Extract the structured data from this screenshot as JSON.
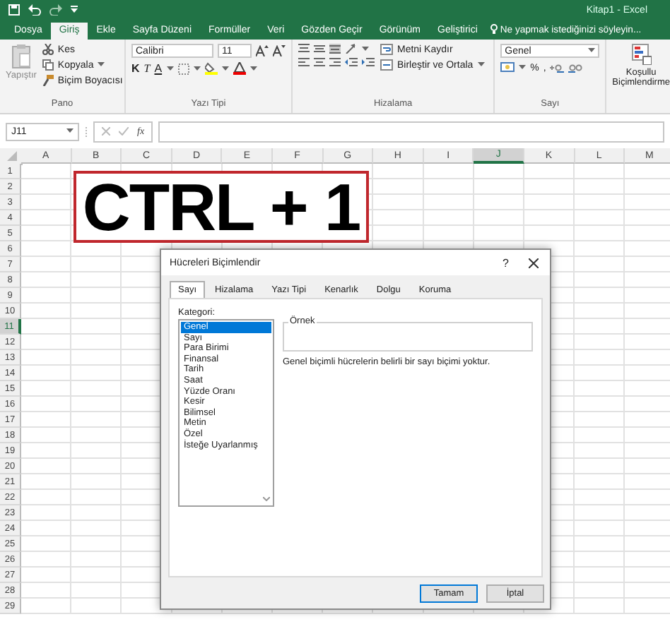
{
  "window": {
    "title": "Kitap1 - Excel"
  },
  "ribbon_tabs": [
    {
      "label": "Dosya",
      "selected": false
    },
    {
      "label": "Giriş",
      "selected": true
    },
    {
      "label": "Ekle",
      "selected": false
    },
    {
      "label": "Sayfa Düzeni",
      "selected": false
    },
    {
      "label": "Formüller",
      "selected": false
    },
    {
      "label": "Veri",
      "selected": false
    },
    {
      "label": "Gözden Geçir",
      "selected": false
    },
    {
      "label": "Görünüm",
      "selected": false
    },
    {
      "label": "Geliştirici",
      "selected": false
    }
  ],
  "tell_me": "Ne yapmak istediğinizi söyleyin...",
  "ribbon": {
    "clipboard": {
      "paste": "Yapıştır",
      "cut": "Kes",
      "copy": "Kopyala",
      "format_painter": "Biçim Boyacısı",
      "group": "Pano"
    },
    "font": {
      "name": "Calibri",
      "size": "11",
      "bold": "K",
      "italic": "T",
      "underline": "A",
      "group": "Yazı Tipi"
    },
    "alignment": {
      "wrap": "Metni Kaydır",
      "merge": "Birleştir ve Ortala",
      "group": "Hizalama"
    },
    "number": {
      "format": "Genel",
      "percent": "%",
      "comma": ",",
      "group": "Sayı"
    },
    "conditional": [
      "Koşullu",
      "Biçimlendirme"
    ]
  },
  "formula_bar": {
    "name_box": "J11",
    "fx": "fx"
  },
  "sheet": {
    "columns": [
      {
        "label": "A",
        "selected": false
      },
      {
        "label": "B",
        "selected": false
      },
      {
        "label": "C",
        "selected": false
      },
      {
        "label": "D",
        "selected": false
      },
      {
        "label": "E",
        "selected": false
      },
      {
        "label": "F",
        "selected": false
      },
      {
        "label": "G",
        "selected": false
      },
      {
        "label": "H",
        "selected": false
      },
      {
        "label": "I",
        "selected": false
      },
      {
        "label": "J",
        "selected": true
      },
      {
        "label": "K",
        "selected": false
      },
      {
        "label": "L",
        "selected": false
      },
      {
        "label": "M",
        "selected": false
      }
    ],
    "rows": [
      {
        "label": "1",
        "selected": false
      },
      {
        "label": "2",
        "selected": false
      },
      {
        "label": "3",
        "selected": false
      },
      {
        "label": "4",
        "selected": false
      },
      {
        "label": "5",
        "selected": false
      },
      {
        "label": "6",
        "selected": false
      },
      {
        "label": "7",
        "selected": false
      },
      {
        "label": "8",
        "selected": false
      },
      {
        "label": "9",
        "selected": false
      },
      {
        "label": "10",
        "selected": false
      },
      {
        "label": "11",
        "selected": true
      },
      {
        "label": "12",
        "selected": false
      },
      {
        "label": "13",
        "selected": false
      },
      {
        "label": "14",
        "selected": false
      },
      {
        "label": "15",
        "selected": false
      },
      {
        "label": "16",
        "selected": false
      },
      {
        "label": "17",
        "selected": false
      },
      {
        "label": "18",
        "selected": false
      },
      {
        "label": "19",
        "selected": false
      },
      {
        "label": "20",
        "selected": false
      },
      {
        "label": "21",
        "selected": false
      },
      {
        "label": "22",
        "selected": false
      },
      {
        "label": "23",
        "selected": false
      },
      {
        "label": "24",
        "selected": false
      },
      {
        "label": "25",
        "selected": false
      },
      {
        "label": "26",
        "selected": false
      },
      {
        "label": "27",
        "selected": false
      },
      {
        "label": "28",
        "selected": false
      },
      {
        "label": "29",
        "selected": false
      }
    ]
  },
  "callout": {
    "text": "CTRL + 1"
  },
  "dialog": {
    "title": "Hücreleri Biçimlendir",
    "help": "?",
    "tabs": [
      {
        "label": "Sayı",
        "selected": true
      },
      {
        "label": "Hizalama",
        "selected": false
      },
      {
        "label": "Yazı Tipi",
        "selected": false
      },
      {
        "label": "Kenarlık",
        "selected": false
      },
      {
        "label": "Dolgu",
        "selected": false
      },
      {
        "label": "Koruma",
        "selected": false
      }
    ],
    "category_label": "Kategori:",
    "categories": [
      {
        "label": "Genel",
        "selected": true
      },
      {
        "label": "Sayı",
        "selected": false
      },
      {
        "label": "Para Birimi",
        "selected": false
      },
      {
        "label": "Finansal",
        "selected": false
      },
      {
        "label": "Tarih",
        "selected": false
      },
      {
        "label": "Saat",
        "selected": false
      },
      {
        "label": "Yüzde Oranı",
        "selected": false
      },
      {
        "label": "Kesir",
        "selected": false
      },
      {
        "label": "Bilimsel",
        "selected": false
      },
      {
        "label": "Metin",
        "selected": false
      },
      {
        "label": "Özel",
        "selected": false
      },
      {
        "label": "İsteğe Uyarlanmış",
        "selected": false
      }
    ],
    "sample_label": "Örnek",
    "description": "Genel biçimli hücrelerin belirli bir sayı biçimi yoktur.",
    "buttons": [
      {
        "label": "Tamam",
        "kind": "default"
      },
      {
        "label": "İptal",
        "kind": "normal"
      }
    ]
  }
}
